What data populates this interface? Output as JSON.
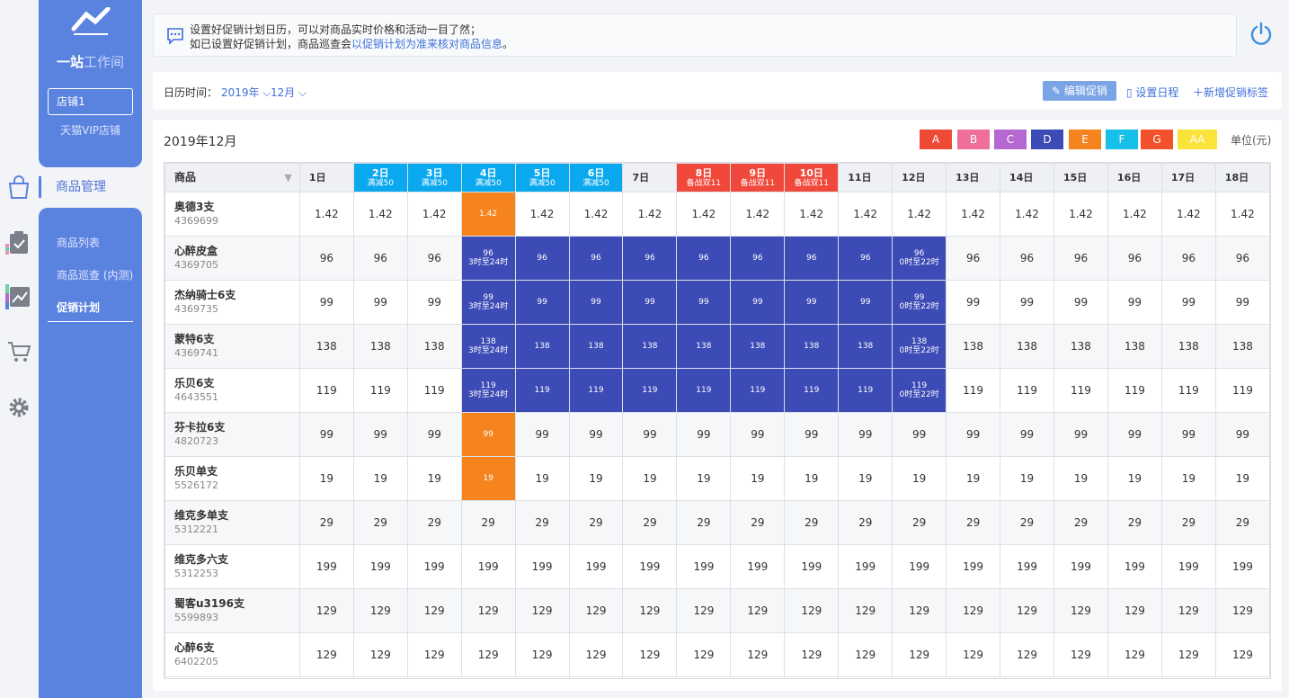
{
  "sidebar": {
    "brand_main": "一站",
    "brand_sub": "工作间",
    "shop_select": "店铺1",
    "shop_name": "天猫VIP店铺",
    "nav_active": "商品管理",
    "sub_items": [
      "商品列表",
      "商品巡查 (内测)",
      "促销计划"
    ]
  },
  "notice": {
    "line1": "设置好促销计划日历，可以对商品实时价格和活动一目了然；",
    "line2_prefix": "如已设置好促销计划，商品巡查会",
    "line2_link": "以促销计划为准来核对商品信息",
    "line2_suffix": "。"
  },
  "toolbar": {
    "label": "日历时间：",
    "year": "2019年",
    "month": "12月",
    "edit_btn": "编辑促销",
    "schedule": "设置日程",
    "add_tag": "新增促销标签"
  },
  "calendar": {
    "title": "2019年12月",
    "unit": "单位(元)",
    "product_header": "商品",
    "tags": [
      {
        "label": "A",
        "color": "#ee4b36"
      },
      {
        "label": "B",
        "color": "#ef6e9b"
      },
      {
        "label": "C",
        "color": "#b468d0"
      },
      {
        "label": "D",
        "color": "#3c4bb5"
      },
      {
        "label": "E",
        "color": "#f5841f"
      },
      {
        "label": "F",
        "color": "#16c0e8"
      },
      {
        "label": "G",
        "color": "#f2512c"
      },
      {
        "label": "AA",
        "color": "#fbe43a"
      }
    ],
    "days": [
      {
        "d": "1日"
      },
      {
        "d": "2日",
        "sub": "满减50",
        "color": "#0aa8ee"
      },
      {
        "d": "3日",
        "sub": "满减50",
        "color": "#0aa8ee"
      },
      {
        "d": "4日",
        "sub": "满减50",
        "color": "#0aa8ee"
      },
      {
        "d": "5日",
        "sub": "满减50",
        "color": "#0aa8ee"
      },
      {
        "d": "6日",
        "sub": "满减50",
        "color": "#0aa8ee"
      },
      {
        "d": "7日"
      },
      {
        "d": "8日",
        "sub": "备战双11",
        "color": "#f0483a"
      },
      {
        "d": "9日",
        "sub": "备战双11",
        "color": "#f0483a"
      },
      {
        "d": "10日",
        "sub": "备战双11",
        "color": "#f0483a"
      },
      {
        "d": "11日"
      },
      {
        "d": "12日"
      },
      {
        "d": "13日"
      },
      {
        "d": "14日"
      },
      {
        "d": "15日"
      },
      {
        "d": "16日"
      },
      {
        "d": "17日"
      },
      {
        "d": "18日"
      }
    ],
    "rows": [
      {
        "name": "奥德3支",
        "id": "4369699",
        "price": "1.42",
        "cells": {
          "3": {
            "t": "or"
          }
        }
      },
      {
        "name": "心醉皮盒",
        "id": "4369705",
        "price": "96",
        "cells": {
          "3": {
            "t": "bl",
            "sub": "3时至24时"
          },
          "4": {
            "t": "bl"
          },
          "5": {
            "t": "bl"
          },
          "6": {
            "t": "bl"
          },
          "7": {
            "t": "bl"
          },
          "8": {
            "t": "bl"
          },
          "9": {
            "t": "bl"
          },
          "10": {
            "t": "bl"
          },
          "11": {
            "t": "bl",
            "sub": "0时至22时"
          }
        }
      },
      {
        "name": "杰纳骑士6支",
        "id": "4369735",
        "price": "99",
        "cells": {
          "3": {
            "t": "bl",
            "sub": "3时至24时"
          },
          "4": {
            "t": "bl"
          },
          "5": {
            "t": "bl"
          },
          "6": {
            "t": "bl"
          },
          "7": {
            "t": "bl"
          },
          "8": {
            "t": "bl"
          },
          "9": {
            "t": "bl"
          },
          "10": {
            "t": "bl"
          },
          "11": {
            "t": "bl",
            "sub": "0时至22时"
          }
        }
      },
      {
        "name": "蒙特6支",
        "id": "4369741",
        "price": "138",
        "cells": {
          "3": {
            "t": "bl",
            "sub": "3时至24时"
          },
          "4": {
            "t": "bl"
          },
          "5": {
            "t": "bl"
          },
          "6": {
            "t": "bl"
          },
          "7": {
            "t": "bl"
          },
          "8": {
            "t": "bl"
          },
          "9": {
            "t": "bl"
          },
          "10": {
            "t": "bl"
          },
          "11": {
            "t": "bl",
            "sub": "0时至22时"
          }
        }
      },
      {
        "name": "乐贝6支",
        "id": "4643551",
        "price": "119",
        "cells": {
          "3": {
            "t": "bl",
            "sub": "3时至24时"
          },
          "4": {
            "t": "bl"
          },
          "5": {
            "t": "bl"
          },
          "6": {
            "t": "bl"
          },
          "7": {
            "t": "bl"
          },
          "8": {
            "t": "bl"
          },
          "9": {
            "t": "bl"
          },
          "10": {
            "t": "bl"
          },
          "11": {
            "t": "bl",
            "sub": "0时至22时"
          }
        }
      },
      {
        "name": "芬卡拉6支",
        "id": "4820723",
        "price": "99",
        "cells": {
          "3": {
            "t": "or"
          }
        }
      },
      {
        "name": "乐贝单支",
        "id": "5526172",
        "price": "19",
        "cells": {
          "3": {
            "t": "or"
          }
        }
      },
      {
        "name": "维克多单支",
        "id": "5312221",
        "price": "29",
        "cells": {}
      },
      {
        "name": "维克多六支",
        "id": "5312253",
        "price": "199",
        "cells": {}
      },
      {
        "name": "蜀客u3196支",
        "id": "5599893",
        "price": "129",
        "cells": {}
      },
      {
        "name": "心醉6支",
        "id": "6402205",
        "price": "129",
        "cells": {}
      }
    ]
  }
}
